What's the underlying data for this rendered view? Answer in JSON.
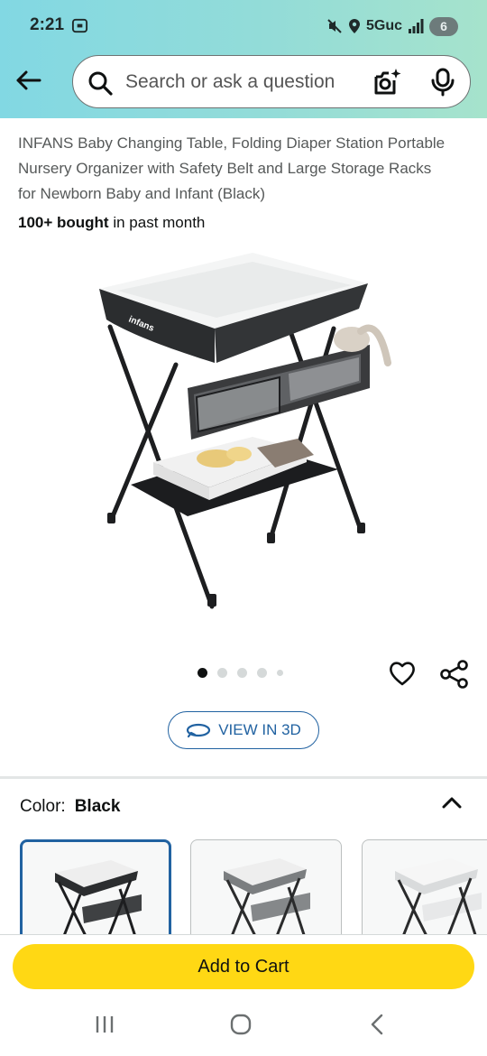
{
  "status_bar": {
    "time": "2:21",
    "network": "5Guc",
    "battery": "6"
  },
  "search": {
    "placeholder": "Search or ask a question"
  },
  "product": {
    "title": "INFANS Baby Changing Table, Folding Diaper Station Portable Nursery Organizer with Safety Belt and Large Storage Racks for Newborn Baby and Infant (Black)",
    "bought_bold": "100+ bought",
    "bought_rest": " in past month",
    "brand_mark": "infans",
    "image_count": 5,
    "active_image": 1
  },
  "view3d": {
    "label": "VIEW IN 3D"
  },
  "color": {
    "label": "Color:",
    "value": "Black"
  },
  "swatches": [
    {
      "name": "Black",
      "selected": true,
      "color": "#2b2d2f"
    },
    {
      "name": "Gray",
      "selected": false,
      "color": "#7b7e80"
    },
    {
      "name": "White",
      "selected": false,
      "color": "#d9dbdc"
    }
  ],
  "cart": {
    "label": "Add to Cart"
  },
  "colors": {
    "accent": "#2162a1",
    "cart_button": "#ffd814",
    "header_gradient_start": "#82d8e3",
    "header_gradient_end": "#a6e3cc"
  }
}
